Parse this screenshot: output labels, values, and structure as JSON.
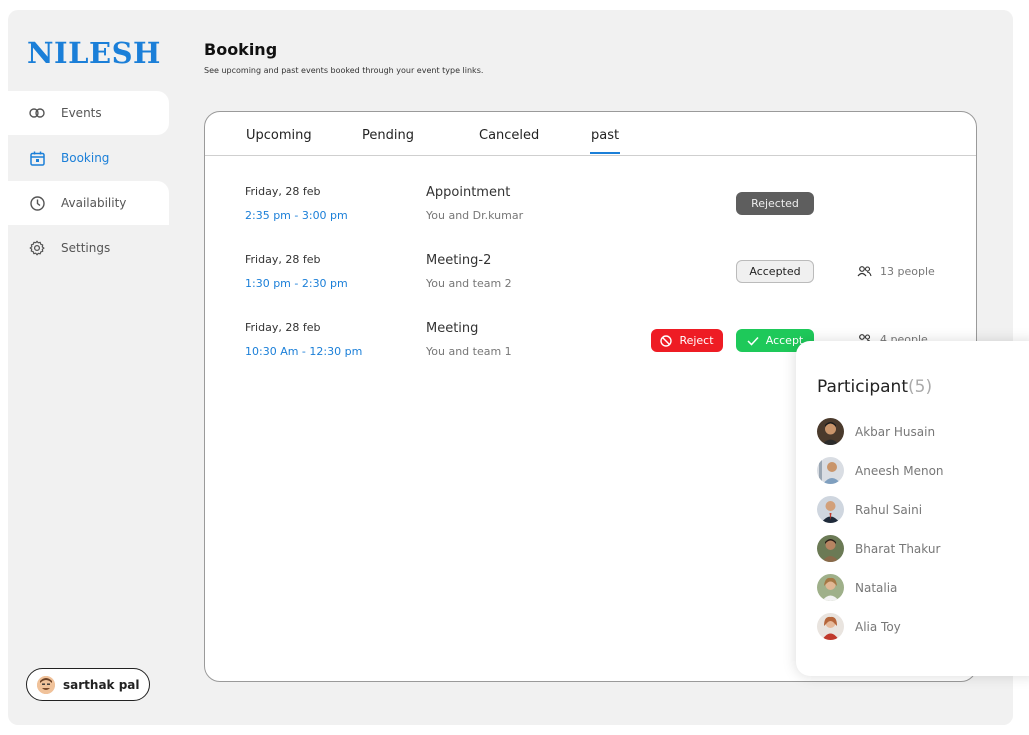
{
  "sidebar": {
    "logo": "NILESH",
    "items": [
      {
        "label": "Events",
        "icon": "link-icon"
      },
      {
        "label": "Booking",
        "icon": "calendar-icon",
        "active": true
      },
      {
        "label": "Availability",
        "icon": "clock-icon"
      },
      {
        "label": "Settings",
        "icon": "gear-icon"
      }
    ],
    "user": {
      "name": "sarthak pal"
    }
  },
  "header": {
    "title": "Booking",
    "subtitle": "See upcoming and past events booked through your event type links."
  },
  "tabs": [
    "Upcoming",
    "Pending",
    "Canceled",
    "past"
  ],
  "active_tab": "past",
  "bookings": [
    {
      "date": "Friday, 28 feb",
      "time": "2:35 pm - 3:00 pm",
      "title": "Appointment",
      "with": "You and Dr.kumar",
      "status": "Rejected"
    },
    {
      "date": "Friday, 28 feb",
      "time": "1:30 pm - 2:30 pm",
      "title": "Meeting-2",
      "with": "You and team 2",
      "status": "Accepted",
      "people": "13 people"
    },
    {
      "date": "Friday, 28 feb",
      "time": "10:30 Am - 12:30 pm",
      "title": "Meeting",
      "with": "You and team 1",
      "reject_label": "Reject",
      "accept_label": "Accept",
      "people": "4 people"
    }
  ],
  "participants": {
    "title": "Participant",
    "count": "(5)",
    "list": [
      "Akbar Husain",
      "Aneesh Menon",
      "Rahul Saini",
      "Bharat Thakur",
      "Natalia",
      "Alia Toy"
    ]
  },
  "colors": {
    "accent": "#1b7fd8",
    "reject": "#ee1c24",
    "accept": "#1ec95a",
    "rejected_badge": "#5e5e5e"
  }
}
